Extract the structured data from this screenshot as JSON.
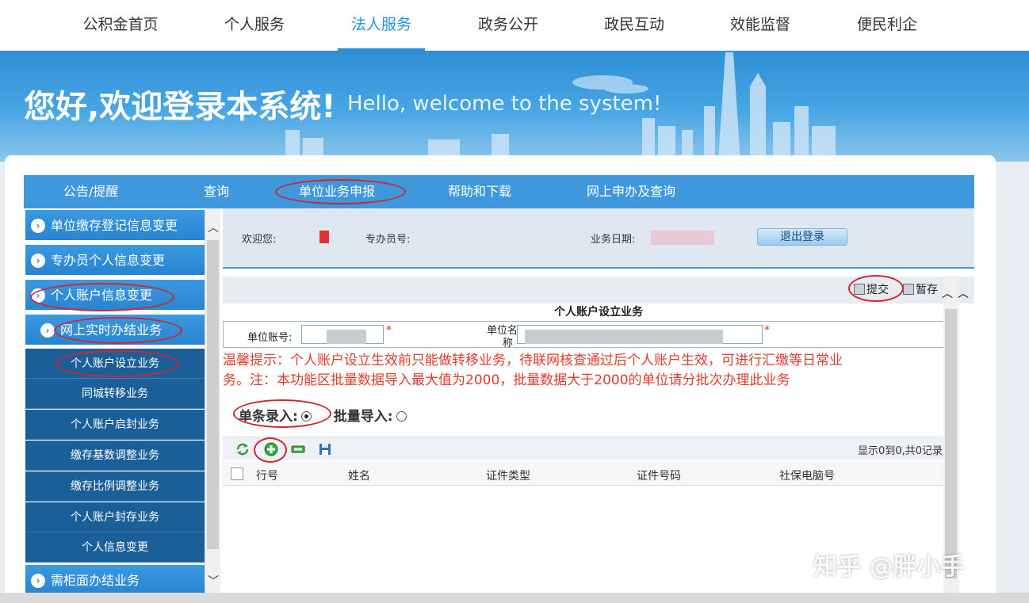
{
  "topnav": {
    "items": [
      "公积金首页",
      "个人服务",
      "法人服务",
      "政务公开",
      "政民互动",
      "效能监督",
      "便民利企"
    ],
    "active_index": 2
  },
  "banner": {
    "title_cn": "您好,欢迎登录本系统!",
    "title_en": "Hello, welcome to the system!"
  },
  "menubar": {
    "items": [
      "公告/提醒",
      "查询",
      "单位业务申报",
      "帮助和下载",
      "网上申办及查询"
    ]
  },
  "sidebar": {
    "items": [
      {
        "label": "单位缴存登记信息变更",
        "type": "main"
      },
      {
        "label": "专办员个人信息变更",
        "type": "main"
      },
      {
        "label": "个人账户信息变更",
        "type": "main"
      },
      {
        "label": "网上实时办结业务",
        "type": "main"
      },
      {
        "label": "个人账户设立业务",
        "type": "sub"
      },
      {
        "label": "同城转移业务",
        "type": "sub"
      },
      {
        "label": "个人账户启封业务",
        "type": "sub"
      },
      {
        "label": "缴存基数调整业务",
        "type": "sub"
      },
      {
        "label": "缴存比例调整业务",
        "type": "sub"
      },
      {
        "label": "个人账户封存业务",
        "type": "sub"
      },
      {
        "label": "个人信息变更",
        "type": "sub"
      },
      {
        "label": "需柜面办结业务",
        "type": "main"
      }
    ]
  },
  "infobar": {
    "welcome_label": "欢迎您:",
    "agent_label": "专办员号:",
    "date_label": "业务日期:",
    "logout_label": "退出登录"
  },
  "toolbar": {
    "submit_label": "提交",
    "save_label": "暂存"
  },
  "form": {
    "title": "个人账户设立业务",
    "unit_account_label": "单位账号:",
    "unit_name_label_1": "单位名",
    "unit_name_label_2": "称",
    "required_mark": "*"
  },
  "tips": {
    "line1": "温馨提示：个人账户设立生效前只能做转移业务，待联网核查通过后个人账户生效，可进行汇缴等日常业",
    "line2": "务。注：本功能区批量数据导入最大值为2000，批量数据大于2000的单位请分批次办理此业务"
  },
  "entry_mode": {
    "single_label": "单条录入:",
    "batch_label": "批量导入:",
    "selected": "single"
  },
  "grid": {
    "count_text": "显示0到0,共0记录",
    "columns": [
      "行号",
      "姓名",
      "证件类型",
      "证件号码",
      "社保电脑号"
    ]
  },
  "watermark": {
    "text": "知乎 @胖小手"
  },
  "colors": {
    "accent": "#3f97dc",
    "highlight_ring": "#d3262b",
    "tip_text": "#e23b2c",
    "sidebar_sub": "#1b5f99"
  }
}
